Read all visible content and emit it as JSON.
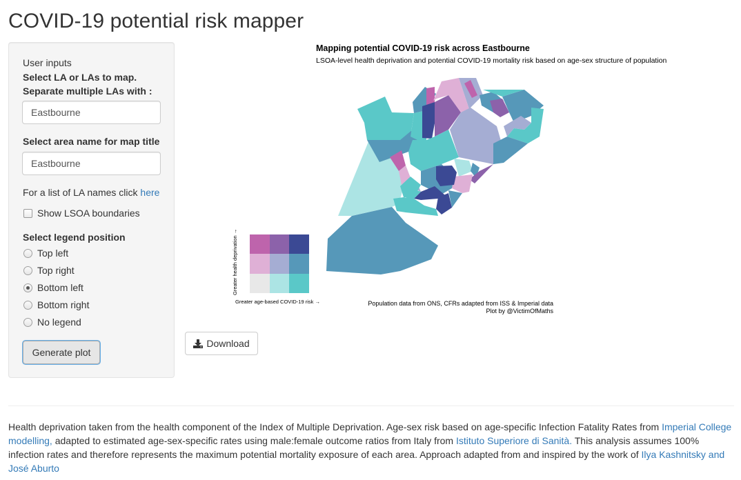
{
  "page": {
    "title": "COVID-19 potential risk mapper"
  },
  "sidebar": {
    "heading": "User inputs",
    "la_label_line1": "Select LA or LAs to map.",
    "la_label_line2": "Separate multiple LAs with :",
    "la_input_value": "Eastbourne",
    "title_label": "Select area name for map title",
    "title_input_value": "Eastbourne",
    "la_list_text": "For a list of LA names click ",
    "la_list_link": "here",
    "show_boundaries_label": "Show LSOA boundaries",
    "show_boundaries_checked": false,
    "legend_position_label": "Select legend position",
    "legend_options": [
      {
        "label": "Top left",
        "selected": false
      },
      {
        "label": "Top right",
        "selected": false
      },
      {
        "label": "Bottom left",
        "selected": true
      },
      {
        "label": "Bottom right",
        "selected": false
      },
      {
        "label": "No legend",
        "selected": false
      }
    ],
    "generate_button": "Generate plot"
  },
  "plot": {
    "title": "Mapping potential COVID-19 risk across Eastbourne",
    "subtitle": "LSOA-level health deprivation and potential COVID-19 mortality risk based on age-sex structure of population",
    "caption_line1": "Population data from ONS, CFRs adapted from ISS & Imperial data",
    "caption_line2": "Plot by @VictimOfMaths",
    "legend": {
      "y_label": "Greater health deprivation →",
      "x_label": "Greater age-based COVID-19 risk →",
      "colors_top_to_bottom": [
        [
          "#be64ac",
          "#8c62aa",
          "#3b4994"
        ],
        [
          "#dfb0d6",
          "#a5add3",
          "#5698b9"
        ],
        [
          "#e8e8e8",
          "#ace4e4",
          "#5ac8c8"
        ]
      ]
    }
  },
  "download_button": {
    "label": "Download",
    "icon": "download-icon"
  },
  "footer": {
    "segments": [
      {
        "text": "Health deprivation taken from the health component of the Index of Multiple Deprivation. Age-sex risk based on age-specific Infection Fatality Rates from ",
        "link": false
      },
      {
        "text": "Imperial College modelling,",
        "link": true
      },
      {
        "text": " adapted to estimated age-sex-specific rates using male:female outcome ratios from Italy from ",
        "link": false
      },
      {
        "text": "Istituto Superiore di Sanità.",
        "link": true
      },
      {
        "text": " This analysis assumes 100% infection rates and therefore represents the maximum potential mortality exposure of each area. Approach adapted from and inspired by the work of ",
        "link": false
      },
      {
        "text": "Ilya Kashnitsky and José Aburto",
        "link": true
      }
    ]
  }
}
